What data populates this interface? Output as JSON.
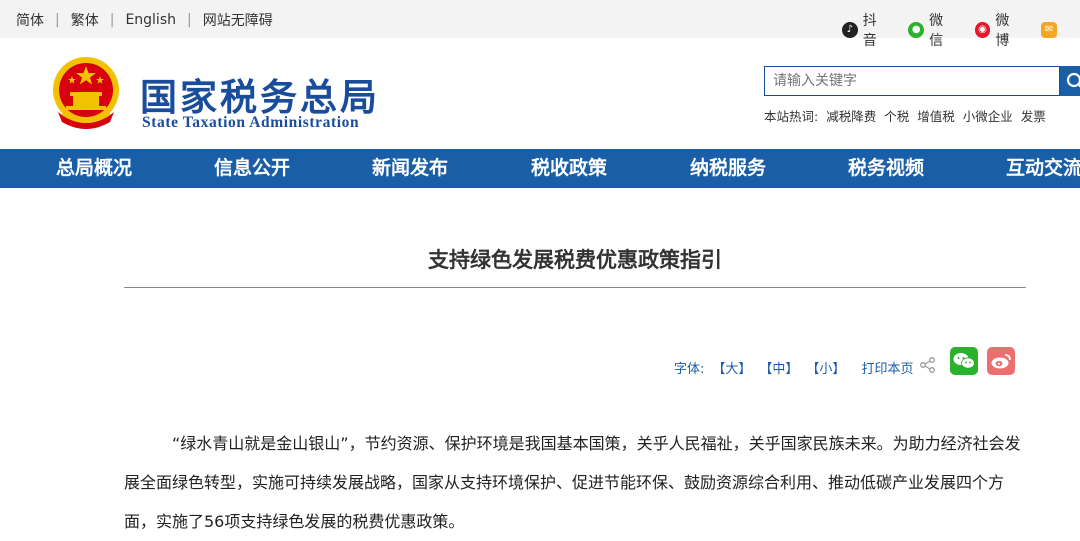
{
  "topbar": {
    "languages": [
      "简体",
      "繁体",
      "English",
      "网站无障碍"
    ],
    "social": [
      {
        "label": "抖音",
        "icon": "douyin-icon"
      },
      {
        "label": "微信",
        "icon": "wechat-icon"
      },
      {
        "label": "微博",
        "icon": "weibo-icon"
      }
    ]
  },
  "header": {
    "site_name_cn": "国家税务总局",
    "site_name_en": "State Taxation Administration",
    "search_placeholder": "请输入关键字",
    "hot_label": "本站热词:",
    "hot_words": [
      "减税降费",
      "个税",
      "增值税",
      "小微企业",
      "发票"
    ]
  },
  "nav": {
    "items": [
      "总局概况",
      "信息公开",
      "新闻发布",
      "税收政策",
      "纳税服务",
      "税务视频",
      "互动交流"
    ]
  },
  "article": {
    "title": "支持绿色发展税费优惠政策指引",
    "font_label": "字体:",
    "font_large": "【大】",
    "font_medium": "【中】",
    "font_small": "【小】",
    "print_label": "打印本页",
    "paragraph": "“绿水青山就是金山银山”，节约资源、保护环境是我国基本国策，关乎人民福祉，关乎国家民族未来。为助力经济社会发展全面绿色转型，实施可持续发展战略，国家从支持环境保护、促进节能环保、鼓励资源综合利用、推动低碳产业发展四个方面，实施了56项支持绿色发展的税费优惠政策。"
  },
  "colors": {
    "brand_blue": "#1a4c9c",
    "nav_blue": "#1a5ea8",
    "emblem_red": "#d7000f",
    "emblem_gold": "#f2c200"
  }
}
